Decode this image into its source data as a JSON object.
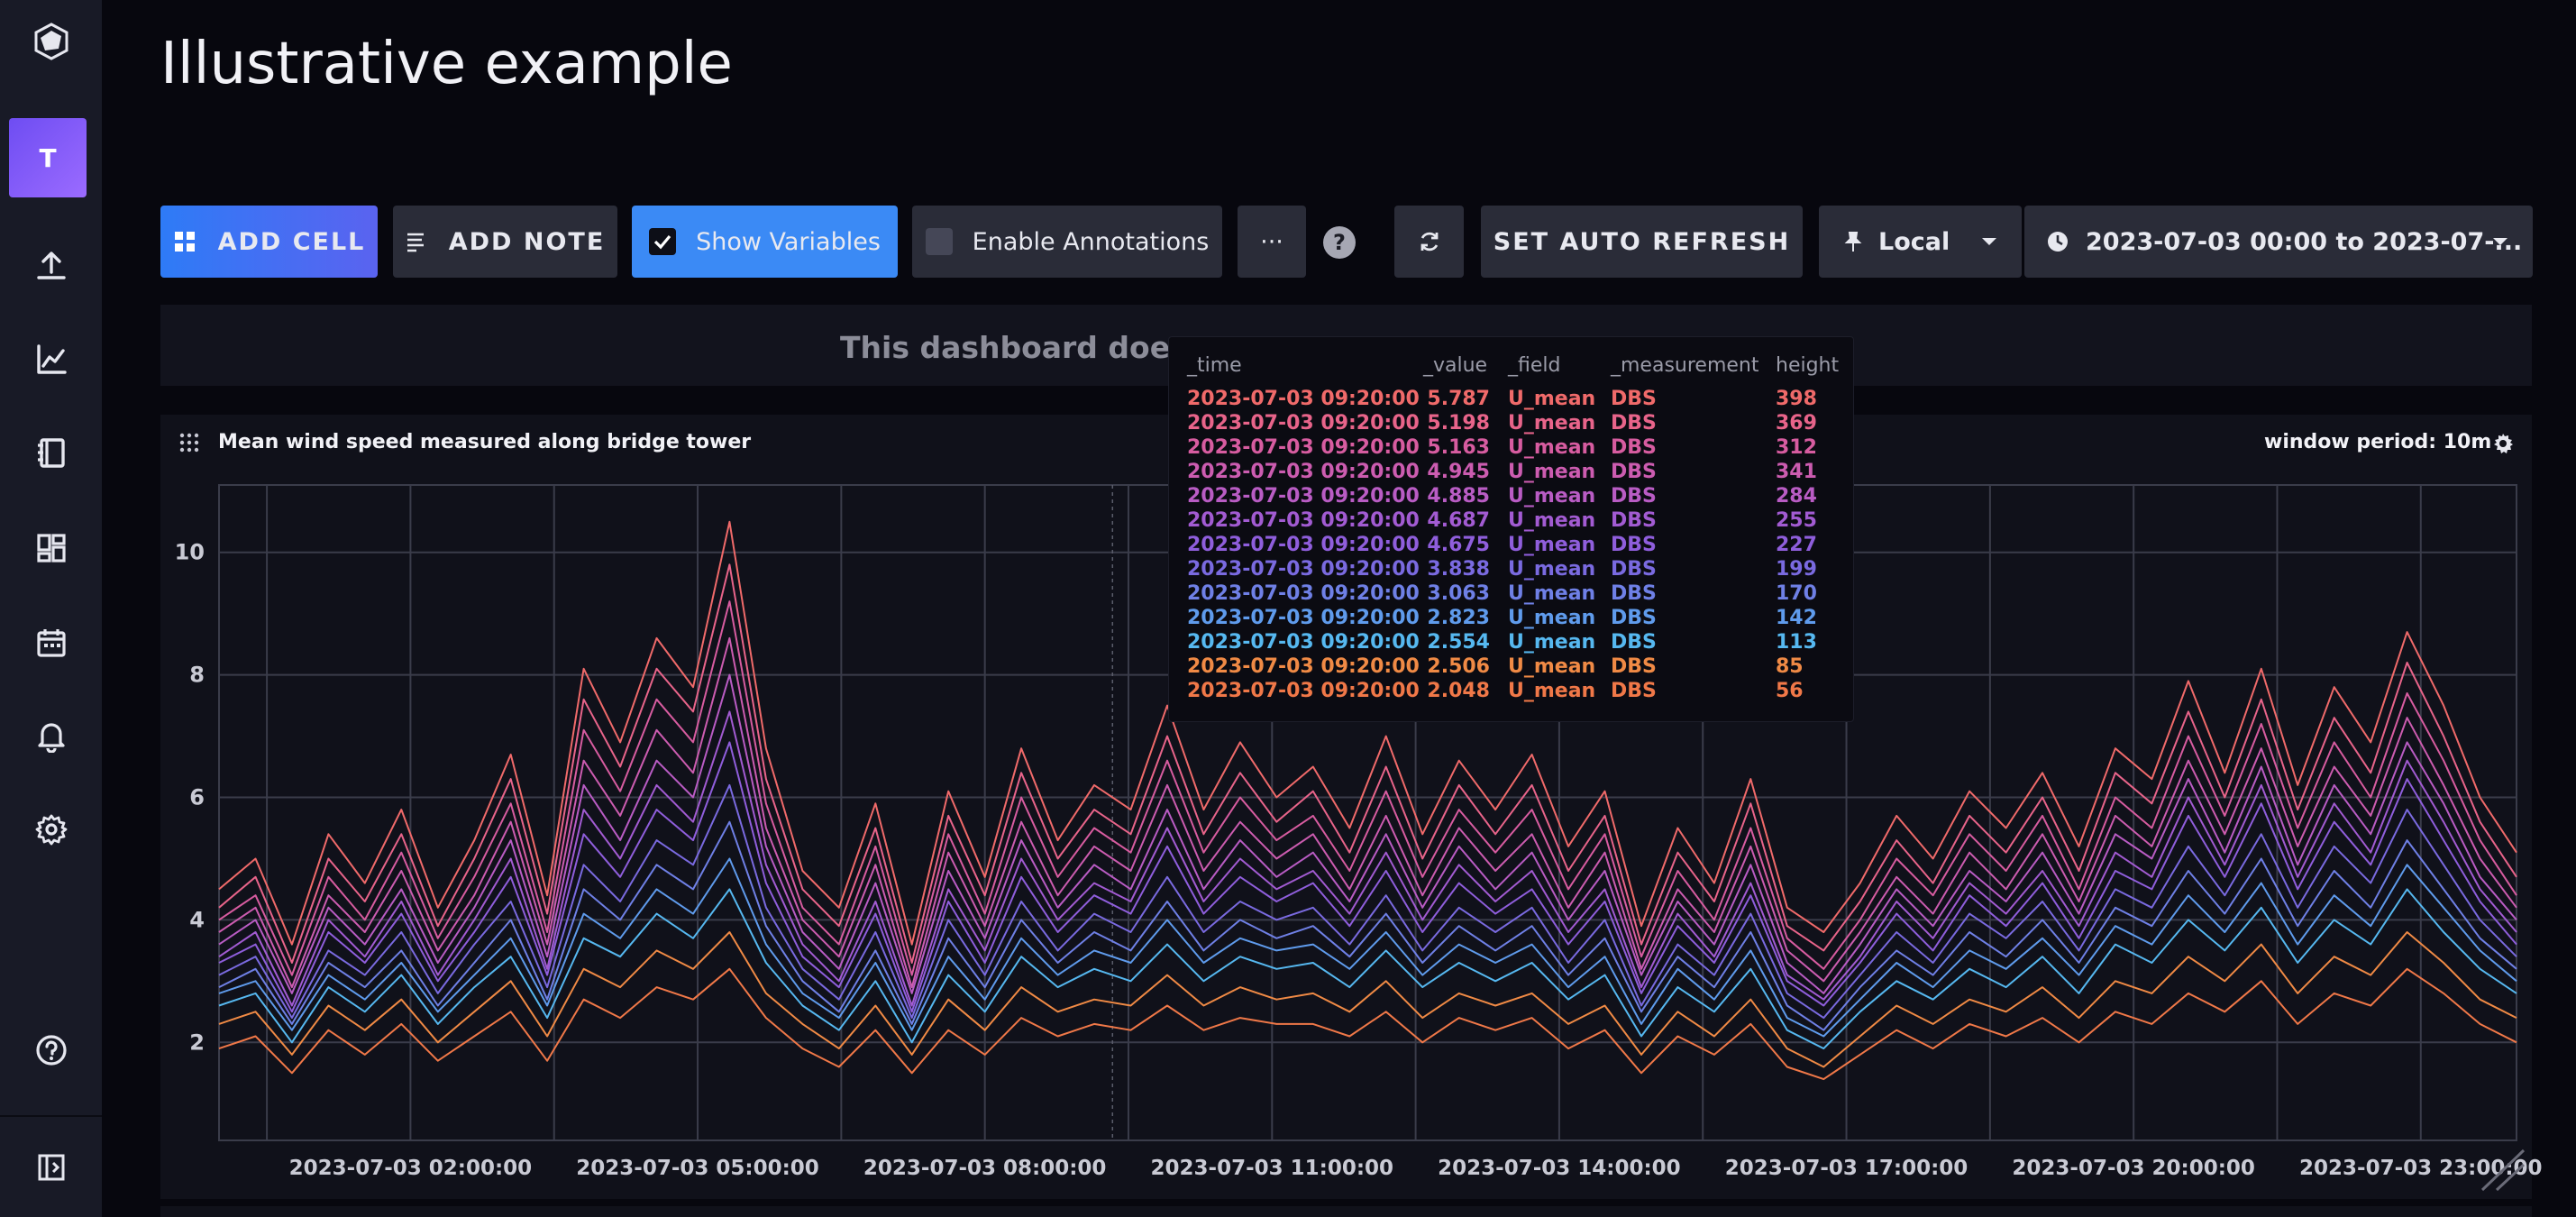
{
  "app": {
    "avatar_letter": "T",
    "page_title": "Illustrative example"
  },
  "toolbar": {
    "add_cell": "ADD CELL",
    "add_note": "ADD NOTE",
    "show_variables": "Show Variables",
    "enable_annotations": "Enable Annotations",
    "more": "···",
    "help": "?",
    "set_auto_refresh": "SET AUTO REFRESH",
    "timezone": "Local",
    "time_range": "2023-07-03 00:00 to 2023-07-..."
  },
  "banner": {
    "text": "This dashboard doesn't"
  },
  "cell": {
    "title": "Mean wind speed measured along bridge tower",
    "window_period": "window period: 10m"
  },
  "tooltip": {
    "headers": [
      "_time",
      "_value",
      "_field",
      "_measurement",
      "height"
    ],
    "rows": [
      {
        "time": "2023-07-03 09:20:00",
        "value": "5.787",
        "field": "U_mean",
        "measurement": "DBS",
        "height": "398",
        "color": "#f06a6a"
      },
      {
        "time": "2023-07-03 09:20:00",
        "value": "5.198",
        "field": "U_mean",
        "measurement": "DBS",
        "height": "369",
        "color": "#e8648a"
      },
      {
        "time": "2023-07-03 09:20:00",
        "value": "5.163",
        "field": "U_mean",
        "measurement": "DBS",
        "height": "312",
        "color": "#d75ca0"
      },
      {
        "time": "2023-07-03 09:20:00",
        "value": "4.945",
        "field": "U_mean",
        "measurement": "DBS",
        "height": "341",
        "color": "#cc5cb0"
      },
      {
        "time": "2023-07-03 09:20:00",
        "value": "4.885",
        "field": "U_mean",
        "measurement": "DBS",
        "height": "284",
        "color": "#b95cc4"
      },
      {
        "time": "2023-07-03 09:20:00",
        "value": "4.687",
        "field": "U_mean",
        "measurement": "DBS",
        "height": "255",
        "color": "#a25bd2"
      },
      {
        "time": "2023-07-03 09:20:00",
        "value": "4.675",
        "field": "U_mean",
        "measurement": "DBS",
        "height": "227",
        "color": "#8f5edc"
      },
      {
        "time": "2023-07-03 09:20:00",
        "value": "3.838",
        "field": "U_mean",
        "measurement": "DBS",
        "height": "199",
        "color": "#7a6ae0"
      },
      {
        "time": "2023-07-03 09:20:00",
        "value": "3.063",
        "field": "U_mean",
        "measurement": "DBS",
        "height": "170",
        "color": "#6f80e6"
      },
      {
        "time": "2023-07-03 09:20:00",
        "value": "2.823",
        "field": "U_mean",
        "measurement": "DBS",
        "height": "142",
        "color": "#5f9bec"
      },
      {
        "time": "2023-07-03 09:20:00",
        "value": "2.554",
        "field": "U_mean",
        "measurement": "DBS",
        "height": "113",
        "color": "#56b8f0"
      },
      {
        "time": "2023-07-03 09:20:00",
        "value": "2.506",
        "field": "U_mean",
        "measurement": "DBS",
        "height": "85",
        "color": "#f08a45"
      },
      {
        "time": "2023-07-03 09:20:00",
        "value": "2.048",
        "field": "U_mean",
        "measurement": "DBS",
        "height": "56",
        "color": "#f07848"
      }
    ]
  },
  "chart_data": {
    "type": "line",
    "title": "Mean wind speed measured along bridge tower",
    "xlabel": "",
    "ylabel": "",
    "ylim": [
      0.4,
      11.1
    ],
    "y_ticks": [
      2,
      4,
      6,
      8,
      10
    ],
    "x_tick_labels": [
      "2023-07-03 02:00:00",
      "2023-07-03 05:00:00",
      "2023-07-03 08:00:00",
      "2023-07-03 11:00:00",
      "2023-07-03 14:00:00",
      "2023-07-03 17:00:00",
      "2023-07-03 20:00:00",
      "2023-07-03 23:00:00"
    ],
    "x_tick_hours": [
      2,
      5,
      8,
      11,
      14,
      17,
      20,
      23
    ],
    "x_range_hours": [
      0,
      24
    ],
    "grid": true,
    "series": [
      {
        "height": "398",
        "color": "#f06a6a",
        "values": [
          4.5,
          5.0,
          3.6,
          5.4,
          4.6,
          5.8,
          4.2,
          5.3,
          6.7,
          4.4,
          8.1,
          6.9,
          8.6,
          7.8,
          10.5,
          6.8,
          4.8,
          4.2,
          5.9,
          3.6,
          6.1,
          4.7,
          6.8,
          5.3,
          6.2,
          5.8,
          7.5,
          5.8,
          6.9,
          6.0,
          6.5,
          5.5,
          7.0,
          5.4,
          6.6,
          5.8,
          6.7,
          5.2,
          6.1,
          3.9,
          5.5,
          4.6,
          6.3,
          4.2,
          3.8,
          4.6,
          5.7,
          5.0,
          6.1,
          5.5,
          6.4,
          5.2,
          6.8,
          6.3,
          7.9,
          6.4,
          8.1,
          6.2,
          7.8,
          6.9,
          8.7,
          7.5,
          6.0,
          5.1
        ]
      },
      {
        "height": "369",
        "color": "#e8648a",
        "values": [
          4.2,
          4.7,
          3.3,
          5.0,
          4.3,
          5.4,
          3.9,
          5.0,
          6.3,
          4.1,
          7.6,
          6.5,
          8.1,
          7.4,
          9.8,
          6.3,
          4.5,
          3.9,
          5.5,
          3.3,
          5.7,
          4.4,
          6.4,
          5.0,
          5.8,
          5.4,
          7.0,
          5.4,
          6.4,
          5.6,
          6.1,
          5.1,
          6.5,
          5.0,
          6.2,
          5.4,
          6.2,
          4.8,
          5.7,
          3.6,
          5.1,
          4.3,
          5.9,
          3.9,
          3.5,
          4.3,
          5.3,
          4.6,
          5.7,
          5.1,
          6.0,
          4.8,
          6.4,
          5.9,
          7.4,
          6.0,
          7.6,
          5.8,
          7.3,
          6.4,
          8.2,
          7.0,
          5.6,
          4.7
        ]
      },
      {
        "height": "312",
        "color": "#d75ca0",
        "values": [
          4.0,
          4.4,
          3.1,
          4.7,
          4.0,
          5.1,
          3.7,
          4.7,
          5.9,
          3.8,
          7.1,
          6.1,
          7.6,
          6.9,
          9.2,
          5.9,
          4.2,
          3.6,
          5.2,
          3.1,
          5.4,
          4.1,
          6.0,
          4.7,
          5.5,
          5.1,
          6.6,
          5.1,
          6.0,
          5.3,
          5.7,
          4.8,
          6.1,
          4.7,
          5.8,
          5.1,
          5.8,
          4.5,
          5.4,
          3.4,
          4.8,
          4.0,
          5.5,
          3.7,
          3.2,
          4.0,
          5.0,
          4.4,
          5.4,
          4.8,
          5.7,
          4.5,
          6.0,
          5.5,
          7.0,
          5.7,
          7.2,
          5.5,
          6.9,
          6.0,
          7.7,
          6.6,
          5.3,
          4.4
        ]
      },
      {
        "height": "341",
        "color": "#cc5cb0",
        "values": [
          3.8,
          4.2,
          2.9,
          4.4,
          3.8,
          4.8,
          3.5,
          4.4,
          5.6,
          3.6,
          6.6,
          5.7,
          7.1,
          6.4,
          8.6,
          5.5,
          4.0,
          3.4,
          4.9,
          2.9,
          5.1,
          3.9,
          5.6,
          4.4,
          5.2,
          4.8,
          6.2,
          4.8,
          5.6,
          5.0,
          5.4,
          4.5,
          5.7,
          4.4,
          5.5,
          4.8,
          5.4,
          4.2,
          5.1,
          3.2,
          4.5,
          3.8,
          5.2,
          3.5,
          3.0,
          3.8,
          4.7,
          4.1,
          5.1,
          4.5,
          5.4,
          4.3,
          5.7,
          5.2,
          6.6,
          5.4,
          6.8,
          5.2,
          6.5,
          5.7,
          7.3,
          6.2,
          5.0,
          4.2
        ]
      },
      {
        "height": "284",
        "color": "#b95cc4",
        "values": [
          3.6,
          4.0,
          2.8,
          4.2,
          3.6,
          4.5,
          3.3,
          4.2,
          5.3,
          3.4,
          6.2,
          5.3,
          6.6,
          6.0,
          8.0,
          5.2,
          3.8,
          3.2,
          4.6,
          2.8,
          4.8,
          3.7,
          5.3,
          4.2,
          4.9,
          4.5,
          5.8,
          4.5,
          5.3,
          4.7,
          5.1,
          4.3,
          5.4,
          4.2,
          5.2,
          4.5,
          5.1,
          4.0,
          4.8,
          3.1,
          4.3,
          3.6,
          4.9,
          3.3,
          2.8,
          3.6,
          4.5,
          3.9,
          4.8,
          4.3,
          5.1,
          4.1,
          5.4,
          5.0,
          6.3,
          5.1,
          6.5,
          4.9,
          6.2,
          5.4,
          6.9,
          5.9,
          4.7,
          4.0
        ]
      },
      {
        "height": "255",
        "color": "#a25bd2",
        "values": [
          3.4,
          3.8,
          2.6,
          4.0,
          3.4,
          4.3,
          3.1,
          4.0,
          5.0,
          3.2,
          5.8,
          5.0,
          6.2,
          5.6,
          7.4,
          4.9,
          3.6,
          3.0,
          4.3,
          2.6,
          4.5,
          3.5,
          5.0,
          4.0,
          4.6,
          4.3,
          5.5,
          4.3,
          5.0,
          4.5,
          4.8,
          4.1,
          5.1,
          4.0,
          4.9,
          4.3,
          4.8,
          3.8,
          4.5,
          2.9,
          4.1,
          3.4,
          4.6,
          3.1,
          2.7,
          3.4,
          4.3,
          3.7,
          4.6,
          4.1,
          4.8,
          3.9,
          5.1,
          4.7,
          6.0,
          4.9,
          6.2,
          4.7,
          5.9,
          5.1,
          6.6,
          5.6,
          4.5,
          3.8
        ]
      },
      {
        "height": "227",
        "color": "#8f5edc",
        "values": [
          3.3,
          3.6,
          2.5,
          3.8,
          3.3,
          4.1,
          3.0,
          3.8,
          4.7,
          3.1,
          5.4,
          4.7,
          5.8,
          5.3,
          6.9,
          4.6,
          3.4,
          2.9,
          4.1,
          2.5,
          4.3,
          3.3,
          4.7,
          3.8,
          4.4,
          4.1,
          5.2,
          4.1,
          4.7,
          4.3,
          4.6,
          3.9,
          4.8,
          3.8,
          4.6,
          4.1,
          4.5,
          3.6,
          4.3,
          2.8,
          3.9,
          3.3,
          4.4,
          3.0,
          2.6,
          3.3,
          4.1,
          3.5,
          4.4,
          3.9,
          4.6,
          3.7,
          4.8,
          4.5,
          5.7,
          4.7,
          5.9,
          4.5,
          5.6,
          4.9,
          6.3,
          5.3,
          4.3,
          3.6
        ]
      },
      {
        "height": "199",
        "color": "#7a6ae0",
        "values": [
          3.1,
          3.4,
          2.4,
          3.5,
          3.1,
          3.8,
          2.8,
          3.6,
          4.3,
          2.9,
          4.9,
          4.3,
          5.3,
          4.9,
          6.2,
          4.2,
          3.2,
          2.7,
          3.8,
          2.4,
          4.0,
          3.1,
          4.3,
          3.5,
          4.1,
          3.8,
          4.7,
          3.8,
          4.3,
          4.0,
          4.2,
          3.6,
          4.4,
          3.5,
          4.2,
          3.8,
          4.2,
          3.3,
          4.0,
          2.6,
          3.6,
          3.1,
          4.1,
          2.8,
          2.4,
          3.1,
          3.8,
          3.3,
          4.1,
          3.7,
          4.3,
          3.5,
          4.5,
          4.2,
          5.2,
          4.4,
          5.4,
          4.2,
          5.2,
          4.6,
          5.8,
          4.9,
          4.0,
          3.4
        ]
      },
      {
        "height": "170",
        "color": "#6f80e6",
        "values": [
          2.9,
          3.2,
          2.3,
          3.3,
          2.9,
          3.5,
          2.6,
          3.3,
          4.0,
          2.7,
          4.5,
          4.0,
          4.9,
          4.5,
          5.6,
          3.9,
          3.0,
          2.5,
          3.5,
          2.3,
          3.7,
          2.9,
          4.0,
          3.3,
          3.8,
          3.5,
          4.3,
          3.5,
          4.0,
          3.7,
          3.9,
          3.4,
          4.1,
          3.3,
          3.9,
          3.5,
          3.9,
          3.1,
          3.7,
          2.5,
          3.4,
          2.9,
          3.8,
          2.6,
          2.2,
          2.9,
          3.5,
          3.1,
          3.8,
          3.4,
          4.0,
          3.3,
          4.2,
          3.9,
          4.8,
          4.1,
          5.0,
          3.9,
          4.8,
          4.2,
          5.3,
          4.5,
          3.7,
          3.2
        ]
      },
      {
        "height": "142",
        "color": "#5f9bec",
        "values": [
          2.8,
          3.0,
          2.2,
          3.1,
          2.7,
          3.3,
          2.5,
          3.1,
          3.7,
          2.6,
          4.1,
          3.7,
          4.5,
          4.1,
          5.0,
          3.6,
          2.8,
          2.4,
          3.3,
          2.2,
          3.4,
          2.7,
          3.7,
          3.1,
          3.5,
          3.3,
          4.0,
          3.3,
          3.7,
          3.5,
          3.6,
          3.2,
          3.8,
          3.1,
          3.6,
          3.3,
          3.6,
          2.9,
          3.4,
          2.3,
          3.2,
          2.7,
          3.5,
          2.4,
          2.1,
          2.7,
          3.3,
          2.9,
          3.5,
          3.2,
          3.7,
          3.1,
          3.9,
          3.6,
          4.4,
          3.8,
          4.6,
          3.6,
          4.4,
          3.9,
          4.9,
          4.2,
          3.5,
          3.0
        ]
      },
      {
        "height": "113",
        "color": "#56b8f0",
        "values": [
          2.6,
          2.8,
          2.0,
          2.9,
          2.5,
          3.1,
          2.3,
          2.9,
          3.4,
          2.4,
          3.7,
          3.4,
          4.1,
          3.7,
          4.5,
          3.3,
          2.6,
          2.2,
          3.0,
          2.0,
          3.1,
          2.5,
          3.4,
          2.9,
          3.2,
          3.0,
          3.6,
          3.0,
          3.4,
          3.2,
          3.3,
          2.9,
          3.5,
          2.9,
          3.3,
          3.0,
          3.3,
          2.7,
          3.1,
          2.1,
          2.9,
          2.5,
          3.2,
          2.2,
          1.9,
          2.5,
          3.0,
          2.7,
          3.2,
          2.9,
          3.4,
          2.8,
          3.6,
          3.3,
          4.0,
          3.5,
          4.2,
          3.3,
          4.0,
          3.6,
          4.5,
          3.8,
          3.2,
          2.8
        ]
      },
      {
        "height": "85",
        "color": "#f08a45",
        "values": [
          2.3,
          2.5,
          1.8,
          2.6,
          2.2,
          2.7,
          2.0,
          2.5,
          3.0,
          2.1,
          3.2,
          2.9,
          3.5,
          3.2,
          3.8,
          2.8,
          2.3,
          1.9,
          2.6,
          1.8,
          2.7,
          2.2,
          2.9,
          2.5,
          2.7,
          2.6,
          3.1,
          2.6,
          2.9,
          2.7,
          2.8,
          2.5,
          3.0,
          2.4,
          2.8,
          2.6,
          2.8,
          2.3,
          2.6,
          1.8,
          2.5,
          2.1,
          2.7,
          1.9,
          1.6,
          2.1,
          2.6,
          2.3,
          2.7,
          2.5,
          2.9,
          2.4,
          3.0,
          2.8,
          3.4,
          3.0,
          3.6,
          2.8,
          3.4,
          3.1,
          3.8,
          3.3,
          2.7,
          2.4
        ]
      },
      {
        "height": "56",
        "color": "#f07848",
        "values": [
          1.9,
          2.1,
          1.5,
          2.2,
          1.8,
          2.3,
          1.7,
          2.1,
          2.5,
          1.7,
          2.7,
          2.4,
          2.9,
          2.7,
          3.2,
          2.4,
          1.9,
          1.6,
          2.2,
          1.5,
          2.2,
          1.8,
          2.4,
          2.1,
          2.3,
          2.2,
          2.6,
          2.2,
          2.4,
          2.3,
          2.3,
          2.1,
          2.5,
          2.0,
          2.4,
          2.2,
          2.4,
          1.9,
          2.2,
          1.5,
          2.1,
          1.8,
          2.3,
          1.6,
          1.4,
          1.8,
          2.2,
          1.9,
          2.3,
          2.1,
          2.4,
          2.0,
          2.5,
          2.3,
          2.8,
          2.5,
          3.0,
          2.3,
          2.8,
          2.6,
          3.2,
          2.8,
          2.3,
          2.0
        ]
      }
    ]
  }
}
